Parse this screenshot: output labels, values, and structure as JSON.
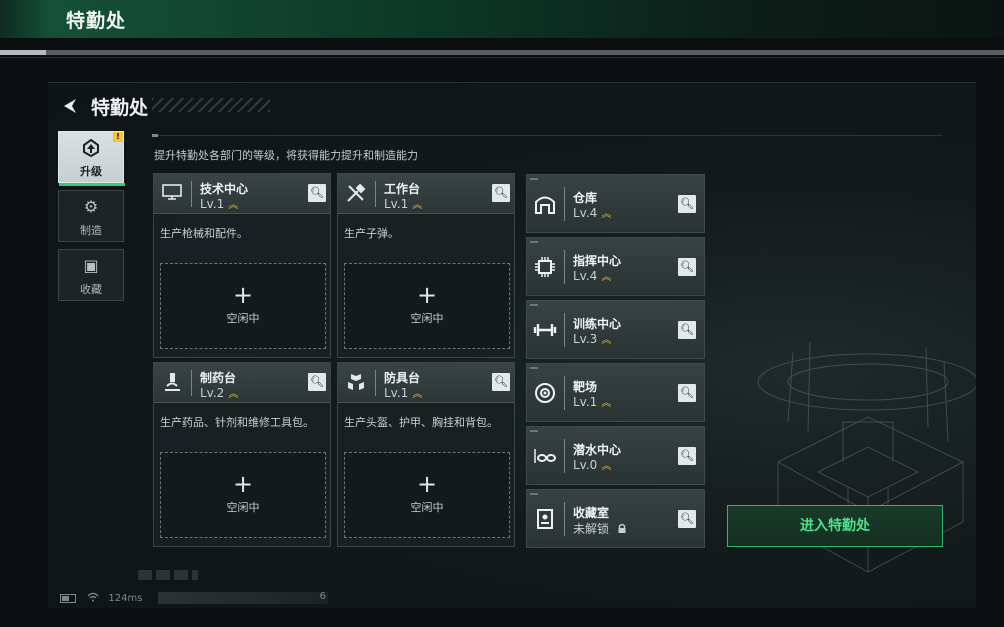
{
  "window_title": "特勤处",
  "page": {
    "title": "特勤处",
    "hint": "提升特勤处各部门的等级，将获得能力提升和制造能力"
  },
  "sidebar": {
    "items": [
      {
        "label": "升级",
        "icon": "upgrade-icon",
        "active": true,
        "badge": "!"
      },
      {
        "label": "制造",
        "icon": "gears-icon",
        "active": false
      },
      {
        "label": "收藏",
        "icon": "collection-icon",
        "active": false
      }
    ]
  },
  "workshops": [
    {
      "name": "技术中心",
      "level": "Lv.1",
      "desc": "生产枪械和配件。",
      "slot_plus": "+",
      "slot_status": "空闲中",
      "icon": "computer-icon"
    },
    {
      "name": "工作台",
      "level": "Lv.1",
      "desc": "生产子弹。",
      "slot_plus": "+",
      "slot_status": "空闲中",
      "icon": "tools-icon"
    },
    {
      "name": "制药台",
      "level": "Lv.2",
      "desc": "生产药品、针剂和维修工具包。",
      "slot_plus": "+",
      "slot_status": "空闲中",
      "icon": "microscope-icon"
    },
    {
      "name": "防具台",
      "level": "Lv.1",
      "desc": "生产头盔、护甲、胸挂和背包。",
      "slot_plus": "+",
      "slot_status": "空闲中",
      "icon": "armor-boxes-icon"
    }
  ],
  "facilities": [
    {
      "name": "仓库",
      "level": "Lv.4",
      "icon": "warehouse-icon"
    },
    {
      "name": "指挥中心",
      "level": "Lv.4",
      "icon": "chip-icon"
    },
    {
      "name": "训练中心",
      "level": "Lv.3",
      "icon": "dumbbell-icon"
    },
    {
      "name": "靶场",
      "level": "Lv.1",
      "icon": "target-icon"
    },
    {
      "name": "潜水中心",
      "level": "Lv.0",
      "icon": "diving-goggles-icon"
    },
    {
      "name": "收藏室",
      "level": "未解锁",
      "icon": "collection-room-icon",
      "locked": true
    }
  ],
  "enter_button": "进入特勤处",
  "status": {
    "ping": "124ms",
    "bottom_number": "6"
  },
  "colors": {
    "accent_green": "#2fd07a",
    "level_chevron": "#e2b637",
    "topbar_green": "#155038"
  }
}
